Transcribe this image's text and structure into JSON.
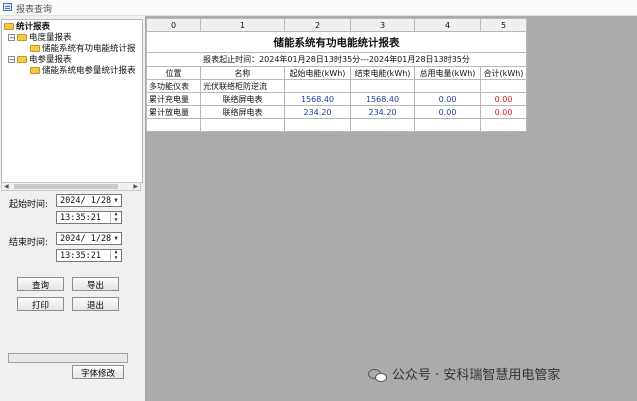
{
  "window": {
    "title": "报表查询"
  },
  "tree": {
    "root": "统计报表",
    "groups": [
      {
        "label": "电度量报表",
        "children": [
          "储能系统有功电能统计报"
        ]
      },
      {
        "label": "电参量报表",
        "children": [
          "储能系统电参量统计报表"
        ]
      }
    ]
  },
  "controls": {
    "start_label": "起始时间:",
    "start_date": "2024/ 1/28",
    "start_time": "13:35:21",
    "end_label": "结束时间:",
    "end_date": "2024/ 1/28",
    "end_time": "13:35:21",
    "query_button": "查询",
    "export_button": "导出",
    "print_button": "打印",
    "exit_button": "退出",
    "font_button": "字体修改"
  },
  "report": {
    "column_numbers": [
      "0",
      "1",
      "2",
      "3",
      "4",
      "5"
    ],
    "title": "储能系统有功电能统计报表",
    "period": "报表起止时间：2024年01月28日13时35分---2024年01月28日13时35分",
    "headers": [
      "位置",
      "名称",
      "起始电能(kWh)",
      "结束电能(kWh)",
      "总用电量(kWh)",
      "合计(kWh)"
    ],
    "rows": [
      [
        "多功能仪表",
        "光伏联络柜防逆流",
        "",
        "",
        "",
        ""
      ],
      [
        "累计充电量",
        "联络屏电表",
        "1568.40",
        "1568.40",
        "0.00",
        "0.00"
      ],
      [
        "累计放电量",
        "联络屏电表",
        "234.20",
        "234.20",
        "0.00",
        "0.00"
      ]
    ]
  },
  "watermark": {
    "text": "公众号 · 安科瑞智慧用电管家"
  },
  "colors": {
    "value_blue": "#1f3fa3",
    "total_red": "#e31a1a",
    "folder_yellow": "#f2c94c"
  }
}
